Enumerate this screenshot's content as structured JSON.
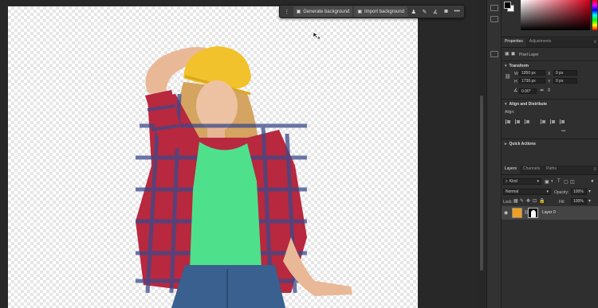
{
  "taskbar": {
    "generate_label": "Generate background",
    "import_label": "Import background",
    "more_label": "•••"
  },
  "properties": {
    "tab_properties": "Properties",
    "tab_adjustments": "Adjustments",
    "layer_type": "Pixel Layer",
    "transform_title": "Transform",
    "w_label": "W",
    "w_value": "1950 px",
    "h_label": "H",
    "h_value": "1736 px",
    "x_label": "X",
    "x_value": "0 px",
    "y_label": "Y",
    "y_value": "0 px",
    "angle_value": "0.00°",
    "align_title": "Align and Distribute",
    "align_label": "Align:",
    "align_more": "•••",
    "quick_actions_title": "Quick Actions"
  },
  "layers": {
    "tab_layers": "Layers",
    "tab_channels": "Channels",
    "tab_paths": "Paths",
    "filter_kind": "Kind",
    "blend_mode": "Normal",
    "opacity_label": "Opacity:",
    "opacity_value": "100%",
    "lock_label": "Lock:",
    "fill_label": "Fill:",
    "fill_value": "100%",
    "layer_name": "Layer 0"
  },
  "colors": {
    "foreground": "#000000",
    "background": "#ffffff",
    "panel_bg": "#2f2f2f",
    "canvas_bg": "#282828"
  }
}
